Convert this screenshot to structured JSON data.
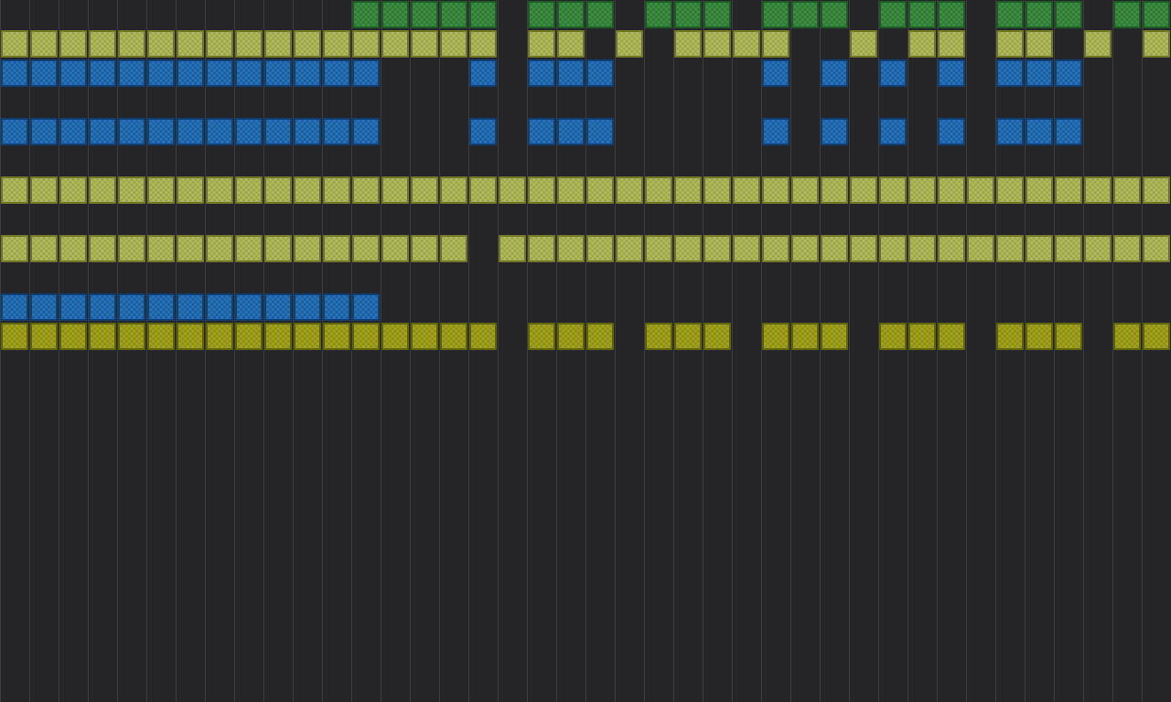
{
  "grid": {
    "columns": 40,
    "rows": 24
  },
  "palette": {
    "board": "#252527",
    "gridline": "#3d3d40",
    "green": {
      "fill": "#2f7a35",
      "border": "#1e5a24",
      "weave": "#5fae5f"
    },
    "olive": {
      "fill": "#9ea84a",
      "border": "#6f7629",
      "weave": "#d4dc86"
    },
    "blue": {
      "fill": "#175fa6",
      "border": "#0e4078",
      "weave": "#5a94d0"
    },
    "yellow": {
      "fill": "#8f8f12",
      "border": "#62620a",
      "weave": "#c4c440"
    }
  },
  "tile_icon": "crosshatch-block",
  "rows": [
    {
      "row": 0,
      "color": "green",
      "pattern": "........................................"
    },
    {
      "row": 1,
      "color": "olive",
      "pattern": "................................................"
    },
    {
      "row": 2,
      "color": "blue",
      "pattern": ""
    },
    {
      "row": 4,
      "color": "blue",
      "pattern": ""
    },
    {
      "row": 6,
      "color": "olive",
      "pattern": ""
    },
    {
      "row": 8,
      "color": "olive",
      "pattern": ""
    },
    {
      "row": 10,
      "color": "blue",
      "pattern": ""
    },
    {
      "row": 11,
      "color": "yellow",
      "pattern": ""
    }
  ],
  "cells": {
    "green_row0": [
      12,
      13,
      14,
      15,
      16,
      18,
      19,
      20,
      22,
      23,
      24,
      26,
      27,
      28,
      30,
      31,
      32,
      34,
      35,
      36,
      38,
      39
    ],
    "olive_row1": [
      0,
      1,
      2,
      3,
      4,
      5,
      6,
      7,
      8,
      9,
      10,
      11,
      12,
      13,
      14,
      15,
      16,
      18,
      19,
      21,
      23,
      24,
      25,
      26,
      29,
      31,
      32,
      34,
      35,
      37,
      39
    ],
    "blue_row2": [
      0,
      1,
      2,
      3,
      4,
      5,
      6,
      7,
      8,
      9,
      10,
      11,
      12,
      16,
      18,
      19,
      20,
      26,
      28,
      30,
      32,
      34,
      35,
      36
    ],
    "blue_row4": [
      0,
      1,
      2,
      3,
      4,
      5,
      6,
      7,
      8,
      9,
      10,
      11,
      12,
      16,
      18,
      19,
      20,
      26,
      28,
      30,
      32,
      34,
      35,
      36
    ],
    "olive_row6": [
      0,
      1,
      2,
      3,
      4,
      5,
      6,
      7,
      8,
      9,
      10,
      11,
      12,
      13,
      14,
      15,
      16,
      17,
      18,
      19,
      20,
      21,
      22,
      23,
      24,
      25,
      26,
      27,
      28,
      29,
      30,
      31,
      32,
      33,
      34,
      35,
      36,
      37,
      38,
      39
    ],
    "olive_row8": [
      0,
      1,
      2,
      3,
      4,
      5,
      6,
      7,
      8,
      9,
      10,
      11,
      12,
      13,
      14,
      15,
      17,
      18,
      19,
      20,
      21,
      22,
      23,
      24,
      25,
      26,
      27,
      28,
      29,
      30,
      31,
      32,
      33,
      34,
      35,
      36,
      37,
      38,
      39
    ],
    "blue_row10": [
      0,
      1,
      2,
      3,
      4,
      5,
      6,
      7,
      8,
      9,
      10,
      11,
      12
    ],
    "yellow_row11": [
      0,
      1,
      2,
      3,
      4,
      5,
      6,
      7,
      8,
      9,
      10,
      11,
      12,
      13,
      14,
      15,
      16,
      18,
      19,
      20,
      22,
      23,
      24,
      26,
      27,
      28,
      30,
      31,
      32,
      34,
      35,
      36,
      38,
      39
    ]
  }
}
